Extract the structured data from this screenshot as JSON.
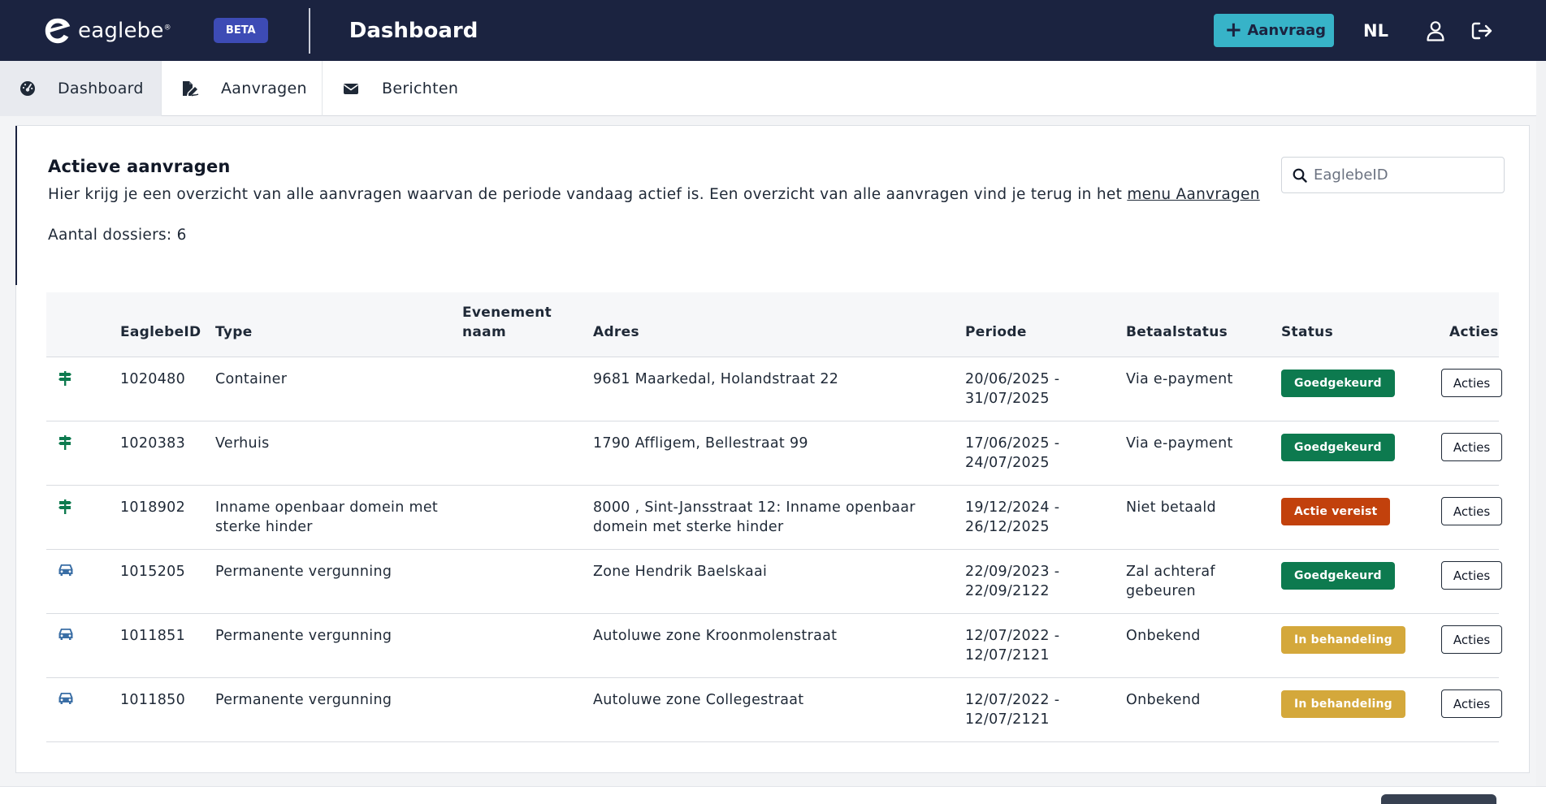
{
  "header": {
    "logo_text": "eaglebe",
    "logo_mark": "®",
    "beta_label": "BETA",
    "page_title": "Dashboard",
    "new_request_label": "Aanvraag",
    "language": "NL"
  },
  "tabs": [
    {
      "label": "Dashboard",
      "icon": "dashboard-icon",
      "active": true
    },
    {
      "label": "Aanvragen",
      "icon": "file-signature-icon",
      "active": false
    },
    {
      "label": "Berichten",
      "icon": "envelope-icon",
      "active": false
    }
  ],
  "main": {
    "title": "Actieve aanvragen",
    "description": "Hier krijg je een overzicht van alle aanvragen waarvan de periode vandaag actief is. Een overzicht van alle aanvragen vind je terug in het ",
    "description_link": "menu Aanvragen",
    "count_label": "Aantal dossiers: 6",
    "search_placeholder": "EaglebeID"
  },
  "table": {
    "columns": {
      "id": "EaglebeID",
      "type": "Type",
      "event_name": "Evenement naam",
      "address": "Adres",
      "period": "Periode",
      "payment": "Betaalstatus",
      "status": "Status",
      "actions": "Acties"
    },
    "rows": [
      {
        "icon": "signpost-icon",
        "id": "1020480",
        "type": "Container",
        "event_name": "",
        "address": "9681 Maarkedal, Holandstraat 22",
        "period": "20/06/2025 - 31/07/2025",
        "payment": "Via e-payment",
        "status": "Goedgekeurd",
        "status_color": "#0d7a4f",
        "action": "Acties"
      },
      {
        "icon": "signpost-icon",
        "id": "1020383",
        "type": "Verhuis",
        "event_name": "",
        "address": "1790 Affligem, Bellestraat 99",
        "period": "17/06/2025 - 24/07/2025",
        "payment": "Via e-payment",
        "status": "Goedgekeurd",
        "status_color": "#0d7a4f",
        "action": "Acties"
      },
      {
        "icon": "signpost-icon",
        "id": "1018902",
        "type": "Inname openbaar domein met sterke hinder",
        "event_name": "",
        "address": "8000 , Sint-Jansstraat 12: Inname openbaar domein met sterke hinder",
        "period": "19/12/2024 - 26/12/2025",
        "payment": "Niet betaald",
        "status": "Actie vereist",
        "status_color": "#c2410c",
        "action": "Acties"
      },
      {
        "icon": "car-icon",
        "id": "1015205",
        "type": "Permanente vergunning",
        "event_name": "",
        "address": "Zone Hendrik Baelskaai",
        "period": "22/09/2023 - 22/09/2122",
        "payment": "Zal achteraf gebeuren",
        "status": "Goedgekeurd",
        "status_color": "#0d7a4f",
        "action": "Acties"
      },
      {
        "icon": "car-icon",
        "id": "1011851",
        "type": "Permanente vergunning",
        "event_name": "",
        "address": "Autoluwe zone Kroonmolenstraat",
        "period": "12/07/2022 - 12/07/2121",
        "payment": "Onbekend",
        "status": "In behandeling",
        "status_color": "#d4a83b",
        "action": "Acties"
      },
      {
        "icon": "car-icon",
        "id": "1011850",
        "type": "Permanente vergunning",
        "event_name": "",
        "address": "Autoluwe zone Collegestraat",
        "period": "12/07/2022 - 12/07/2121",
        "payment": "Onbekend",
        "status": "In behandeling",
        "status_color": "#d4a83b",
        "action": "Acties"
      }
    ]
  },
  "colors": {
    "navbar": "#1b2340",
    "accent": "#37b3c8",
    "beta": "#3d4bb5",
    "icon_green": "#0d7a4f",
    "icon_blue": "#3a6ea5"
  }
}
